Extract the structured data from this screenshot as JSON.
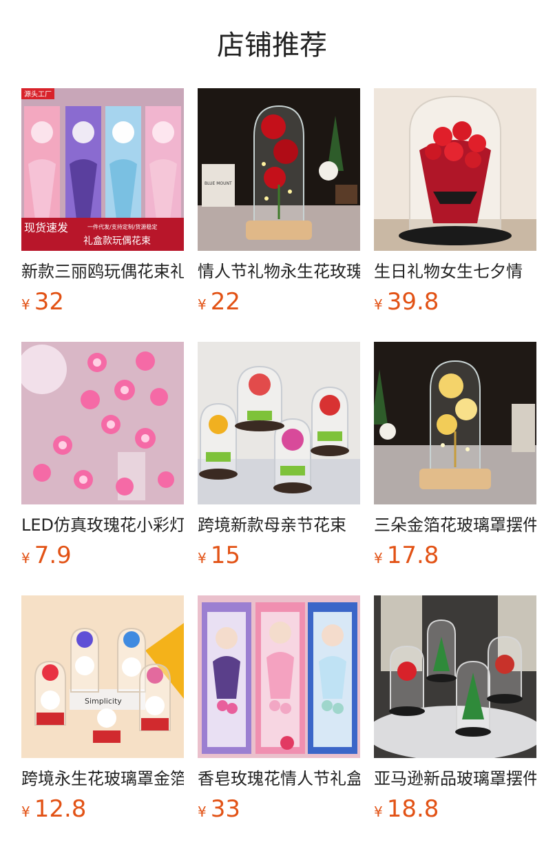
{
  "page_title": "店铺推荐",
  "currency_symbol": "¥",
  "products": [
    {
      "name": "新款三丽鸥玩偶花束礼盒",
      "price": "32",
      "badge_top": "源头工厂",
      "badge_left": "现货速发",
      "badge_right_top": "一件代发/支持定制/货源稳定",
      "badge_right_bottom": "礼盒款玩偶花束"
    },
    {
      "name": "情人节礼物永生花玫瑰",
      "price": "22",
      "jar_label": "BLUE MOUNT"
    },
    {
      "name": "生日礼物女生七夕情",
      "price": "39.8"
    },
    {
      "name": "LED仿真玫瑰花小彩灯",
      "price": "7.9"
    },
    {
      "name": "跨境新款母亲节花束",
      "price": "15"
    },
    {
      "name": "三朵金箔花玻璃罩摆件",
      "price": "17.8"
    },
    {
      "name": "跨境永生花玻璃罩金箔",
      "price": "12.8",
      "box_label": "Simplicity"
    },
    {
      "name": "香皂玫瑰花情人节礼盒",
      "price": "33"
    },
    {
      "name": "亚马逊新品玻璃罩摆件",
      "price": "18.8"
    }
  ]
}
